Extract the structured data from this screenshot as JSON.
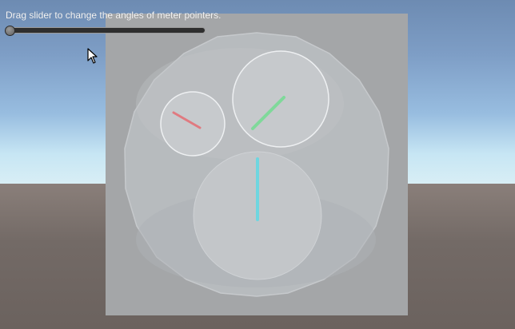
{
  "instruction_text": "Drag slider to change the angles of meter pointers.",
  "slider": {
    "value": 0.0
  },
  "meters": [
    {
      "name": "left-meter",
      "pointer_color": "#e07a80"
    },
    {
      "name": "right-meter",
      "pointer_color": "#7fd99a"
    },
    {
      "name": "bottom-meter",
      "pointer_color": "#6fd6e0"
    }
  ],
  "icons": {
    "cursor": "arrow-cursor-icon"
  }
}
